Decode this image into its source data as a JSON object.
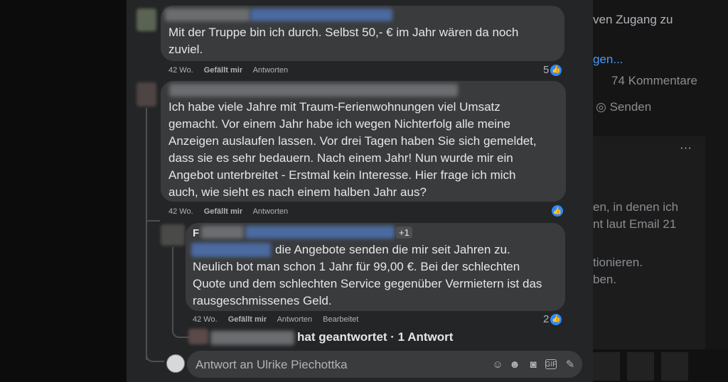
{
  "right_column": {
    "line1": "ven Zugang zu",
    "line2": "gen...",
    "comments_count": "74 Kommentare",
    "send_label": "Senden",
    "more": "···",
    "snip1": "en, in denen ich",
    "snip2": "nt laut Email 21",
    "snip3": "tionieren.",
    "snip4": "ben."
  },
  "comments": [
    {
      "lines": [
        "Mit der Truppe bin ich durch. Selbst 50,- € im Jahr wären da noch",
        "zuviel."
      ],
      "time": "42 Wo.",
      "like": "Gefällt mir",
      "reply": "Antworten",
      "reactions": "5"
    },
    {
      "lines": [
        "Ich habe viele Jahre mit Traum-Ferienwohnungen viel Umsatz",
        "gemacht. Vor einem Jahr habe ich wegen Nichterfolg alle meine",
        "Anzeigen auslaufen lassen. Vor drei Tagen haben Sie sich gemeldet,",
        "dass sie es sehr bedauern. Nach einem Jahr! Nun wurde mir ein",
        "Angebot unterbreitet - Erstmal kein Interesse. Hier frage ich mich",
        "auch, wie sieht es nach einem halben Jahr aus?"
      ],
      "time": "42 Wo.",
      "like": "Gefällt mir",
      "reply": "Antworten",
      "reactions": ""
    },
    {
      "name_initial": "F",
      "mention_badge": "+1",
      "lines": [
        "die Angebote senden die mir seit Jahren zu.",
        "Neulich bot man schon 1 Jahr für 99,00 €. Bei der schlechten",
        "Quote und dem schlechten Service gegenüber Vermietern ist das",
        "rausgeschmissenes Geld."
      ],
      "time": "42 Wo.",
      "like": "Gefällt mir",
      "reply": "Antworten",
      "edited": "Bearbeitet",
      "reactions": "2"
    }
  ],
  "more_replies": "hat geantwortet · 1 Antwort",
  "reply_box": {
    "placeholder": "Antwort an Ulrike Piechottka",
    "icons": [
      "sticker-face-icon",
      "emoji-icon",
      "camera-icon",
      "gif-icon",
      "sticker-icon"
    ]
  },
  "colors": {
    "panel": "#242526",
    "bubble": "#3a3b3c",
    "like_blue": "#2e89ff",
    "muted": "#b0b3b8"
  }
}
